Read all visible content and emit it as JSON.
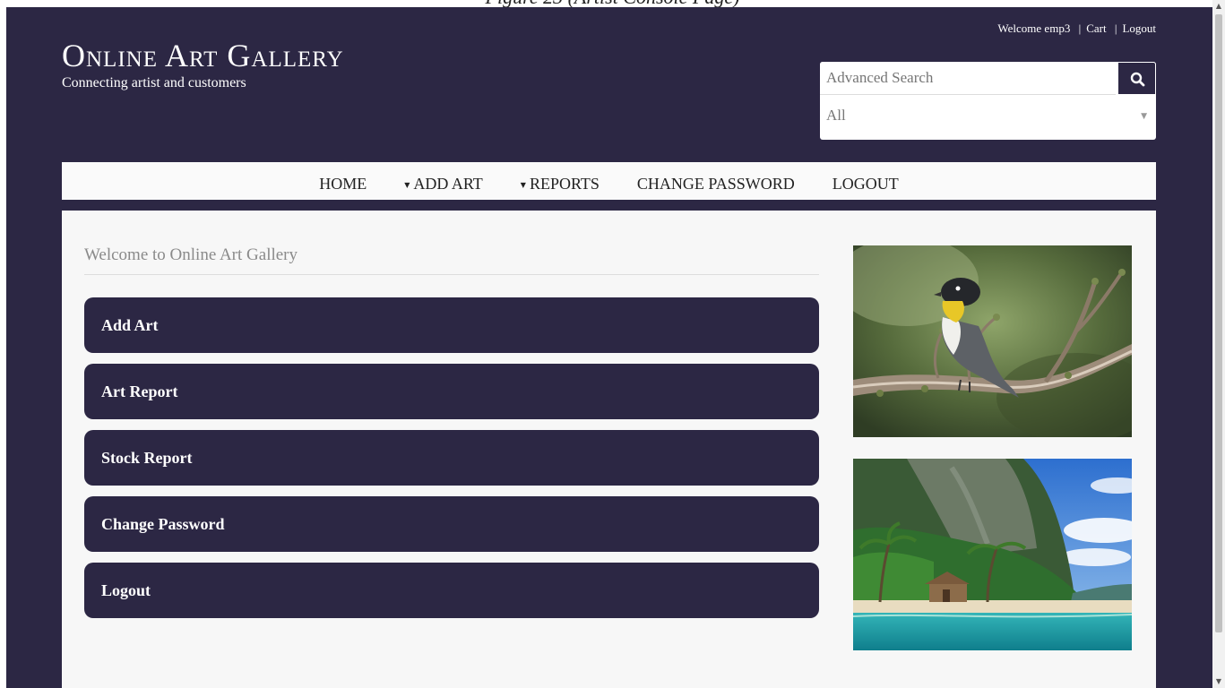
{
  "caption": "Figure 23 (Artist Console Page)",
  "top_links": {
    "welcome": "Welcome emp3",
    "cart": "Cart",
    "logout": "Logout"
  },
  "header": {
    "title": "Online Art Gallery",
    "tagline": "Connecting artist and customers"
  },
  "search": {
    "placeholder": "Advanced Search",
    "category_selected": "All"
  },
  "nav": {
    "home": "HOME",
    "add_art": "ADD ART",
    "reports": "REPORTS",
    "change_password": "CHANGE PASSWORD",
    "logout": "LOGOUT"
  },
  "content": {
    "heading": "Welcome to Online Art Gallery",
    "buttons": [
      "Add Art",
      "Art Report",
      "Stock Report",
      "Change Password",
      "Logout"
    ]
  },
  "colors": {
    "brand": "#2c2744",
    "content_bg": "#f7f7f7"
  },
  "icons": {
    "search": "search-icon",
    "dropdown": "chevron-down-icon"
  }
}
